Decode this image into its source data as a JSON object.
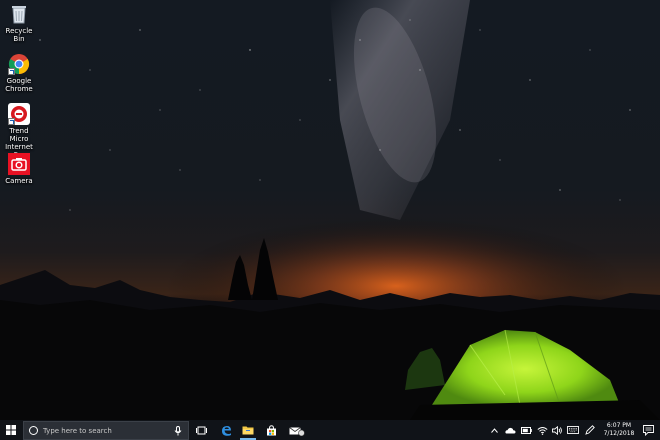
{
  "desktop": {
    "icons": [
      {
        "label": "Recycle Bin",
        "icon": "recycle-bin-icon"
      },
      {
        "label": "Google Chrome",
        "icon": "chrome-icon"
      },
      {
        "label": "Trend Micro Internet S...",
        "icon": "trend-micro-icon"
      },
      {
        "label": "Camera",
        "icon": "camera-icon"
      }
    ]
  },
  "taskbar": {
    "search_placeholder": "Type here to search",
    "apps": [
      "task-view-icon",
      "edge-icon",
      "file-explorer-icon",
      "store-icon",
      "mail-icon"
    ],
    "tray_icons": [
      "chevron-up-icon",
      "onedrive-icon",
      "battery-icon",
      "wifi-icon",
      "volume-icon",
      "keyboard-icon",
      "pen-icon"
    ],
    "clock": {
      "time": "6:07 PM",
      "date": "7/12/2018"
    },
    "colors": {
      "accent": "#76b9ed",
      "taskbar": "#101318",
      "search_box": "#2b2f36"
    }
  }
}
